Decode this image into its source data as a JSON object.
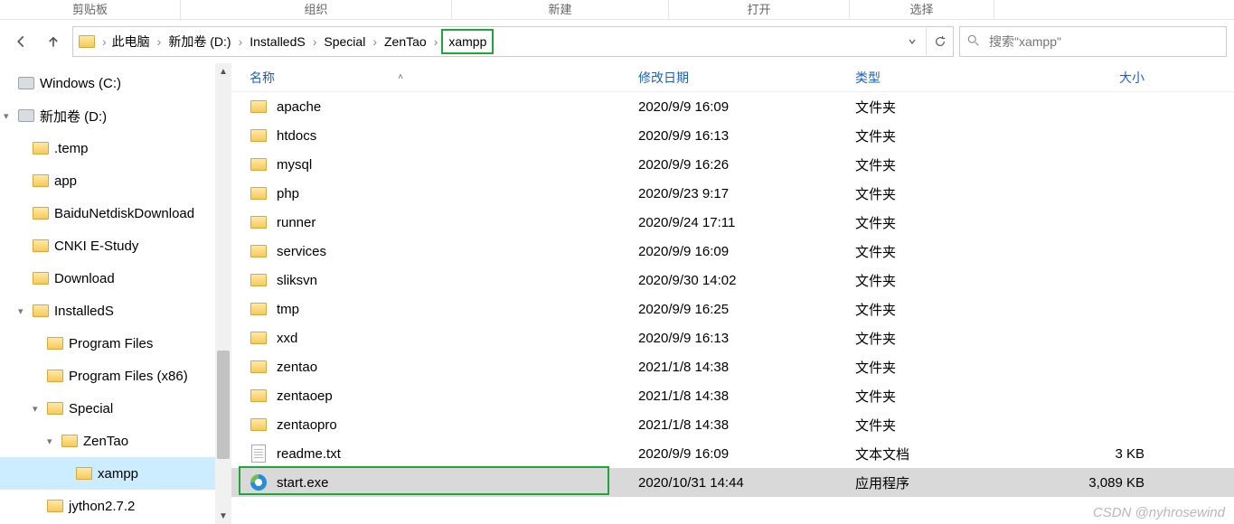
{
  "ribbon": {
    "groups": [
      "剪贴板",
      "组织",
      "新建",
      "打开",
      "选择"
    ]
  },
  "breadcrumb": {
    "crumbs": [
      "此电脑",
      "新加卷 (D:)",
      "InstalledS",
      "Special",
      "ZenTao"
    ],
    "current": "xampp"
  },
  "search": {
    "placeholder": "搜索\"xampp\""
  },
  "tree": {
    "items": [
      {
        "label": "Windows  (C:)",
        "indent": 0,
        "twisty": "",
        "icon": "drive"
      },
      {
        "label": "新加卷 (D:)",
        "indent": 0,
        "twisty": "▾",
        "icon": "drive"
      },
      {
        "label": ".temp",
        "indent": 1,
        "twisty": "",
        "icon": "folder"
      },
      {
        "label": "app",
        "indent": 1,
        "twisty": "",
        "icon": "folder"
      },
      {
        "label": "BaiduNetdiskDownload",
        "indent": 1,
        "twisty": "",
        "icon": "folder"
      },
      {
        "label": "CNKI E-Study",
        "indent": 1,
        "twisty": "",
        "icon": "folder"
      },
      {
        "label": "Download",
        "indent": 1,
        "twisty": "",
        "icon": "folder"
      },
      {
        "label": "InstalledS",
        "indent": 1,
        "twisty": "▾",
        "icon": "folder"
      },
      {
        "label": "Program Files",
        "indent": 2,
        "twisty": "",
        "icon": "folder"
      },
      {
        "label": "Program Files (x86)",
        "indent": 2,
        "twisty": "",
        "icon": "folder"
      },
      {
        "label": "Special",
        "indent": 2,
        "twisty": "▾",
        "icon": "folder"
      },
      {
        "label": "ZenTao",
        "indent": 3,
        "twisty": "▾",
        "icon": "folder"
      },
      {
        "label": "xampp",
        "indent": 4,
        "twisty": "",
        "icon": "folder",
        "selected": true
      },
      {
        "label": "jython2.7.2",
        "indent": 2,
        "twisty": "",
        "icon": "folder"
      }
    ]
  },
  "columns": {
    "name": "名称",
    "date": "修改日期",
    "type": "类型",
    "size": "大小"
  },
  "files": [
    {
      "name": "apache",
      "date": "2020/9/9 16:09",
      "type": "文件夹",
      "size": "",
      "icon": "folder"
    },
    {
      "name": "htdocs",
      "date": "2020/9/9 16:13",
      "type": "文件夹",
      "size": "",
      "icon": "folder"
    },
    {
      "name": "mysql",
      "date": "2020/9/9 16:26",
      "type": "文件夹",
      "size": "",
      "icon": "folder"
    },
    {
      "name": "php",
      "date": "2020/9/23 9:17",
      "type": "文件夹",
      "size": "",
      "icon": "folder"
    },
    {
      "name": "runner",
      "date": "2020/9/24 17:11",
      "type": "文件夹",
      "size": "",
      "icon": "folder"
    },
    {
      "name": "services",
      "date": "2020/9/9 16:09",
      "type": "文件夹",
      "size": "",
      "icon": "folder"
    },
    {
      "name": "sliksvn",
      "date": "2020/9/30 14:02",
      "type": "文件夹",
      "size": "",
      "icon": "folder"
    },
    {
      "name": "tmp",
      "date": "2020/9/9 16:25",
      "type": "文件夹",
      "size": "",
      "icon": "folder"
    },
    {
      "name": "xxd",
      "date": "2020/9/9 16:13",
      "type": "文件夹",
      "size": "",
      "icon": "folder"
    },
    {
      "name": "zentao",
      "date": "2021/1/8 14:38",
      "type": "文件夹",
      "size": "",
      "icon": "folder"
    },
    {
      "name": "zentaoep",
      "date": "2021/1/8 14:38",
      "type": "文件夹",
      "size": "",
      "icon": "folder"
    },
    {
      "name": "zentaopro",
      "date": "2021/1/8 14:38",
      "type": "文件夹",
      "size": "",
      "icon": "folder"
    },
    {
      "name": "readme.txt",
      "date": "2020/9/9 16:09",
      "type": "文本文档",
      "size": "3 KB",
      "icon": "doc"
    },
    {
      "name": "start.exe",
      "date": "2020/10/31 14:44",
      "type": "应用程序",
      "size": "3,089 KB",
      "icon": "exe",
      "selected": true,
      "highlight": true
    }
  ],
  "watermark": "CSDN @nyhrosewind"
}
